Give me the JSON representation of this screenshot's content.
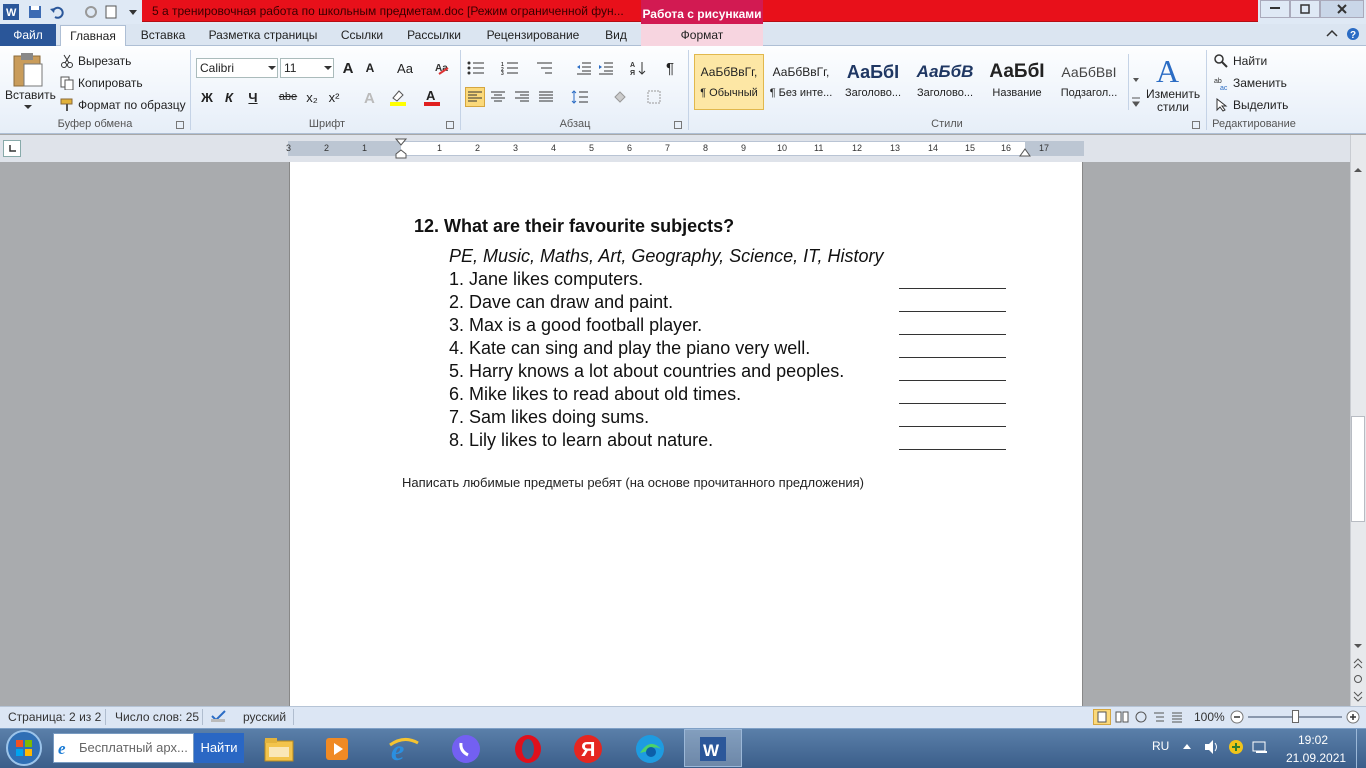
{
  "window": {
    "title": "5 а тренировочная работа по школьным предметам.doc [Режим ограниченной фун...",
    "context_tab": "Работа с рисунками"
  },
  "tabs": [
    "Файл",
    "Главная",
    "Вставка",
    "Разметка страницы",
    "Ссылки",
    "Рассылки",
    "Рецензирование",
    "Вид",
    "Формат"
  ],
  "clipboard": {
    "paste": "Вставить",
    "cut": "Вырезать",
    "copy": "Копировать",
    "format_painter": "Формат по образцу",
    "label": "Буфер обмена"
  },
  "font": {
    "name": "Calibri",
    "size": "11",
    "label": "Шрифт",
    "bold": "Ж",
    "italic": "К",
    "underline": "Ч",
    "strike": "abe",
    "sub": "x₂",
    "sup": "x²",
    "grow": "A",
    "shrink": "A",
    "case": "Aa"
  },
  "paragraph": {
    "label": "Абзац"
  },
  "styles": {
    "label": "Стили",
    "items": [
      {
        "preview": "АаБбВвГг,",
        "name": "¶ Обычный"
      },
      {
        "preview": "АаБбВвГг,",
        "name": "¶ Без инте..."
      },
      {
        "preview": "АаБбІ",
        "name": "Заголово..."
      },
      {
        "preview": "АаБбВ",
        "name": "Заголово..."
      },
      {
        "preview": "АаБбІ",
        "name": "Название"
      },
      {
        "preview": "АаБбВвІ",
        "name": "Подзагол..."
      }
    ],
    "change": "Изменить стили"
  },
  "editing": {
    "label": "Редактирование",
    "find": "Найти",
    "replace": "Заменить",
    "select": "Выделить"
  },
  "ruler": {
    "numbers": [
      "3",
      "2",
      "1",
      "1",
      "2",
      "3",
      "4",
      "5",
      "6",
      "7",
      "8",
      "9",
      "10",
      "11",
      "12",
      "13",
      "14",
      "15",
      "16",
      "17"
    ]
  },
  "document": {
    "heading": "12.  What are their favourite subjects?",
    "subjects": "PE, Music, Maths, Art, Geography, Science, IT, History",
    "items": [
      "1.  Jane likes computers.",
      "2.  Dave can draw and paint.",
      "3.  Max is a good football player.",
      "4.  Kate can sing and play the piano very well.",
      "5.  Harry knows a lot about countries and peoples.",
      "6.  Mike likes to read about old times.",
      "7.  Sam likes doing sums.",
      "8.  Lily likes to learn about nature."
    ],
    "instruction": "Написать любимые предметы ребят (на основе прочитанного предложения)"
  },
  "status": {
    "page": "Страница: 2 из 2",
    "words": "Число слов: 25",
    "language": "русский",
    "zoom": "100%"
  },
  "taskbar": {
    "search_placeholder": "Бесплатный арх...",
    "search_button": "Найти",
    "lang": "RU",
    "time": "19:02",
    "date": "21.09.2021"
  }
}
